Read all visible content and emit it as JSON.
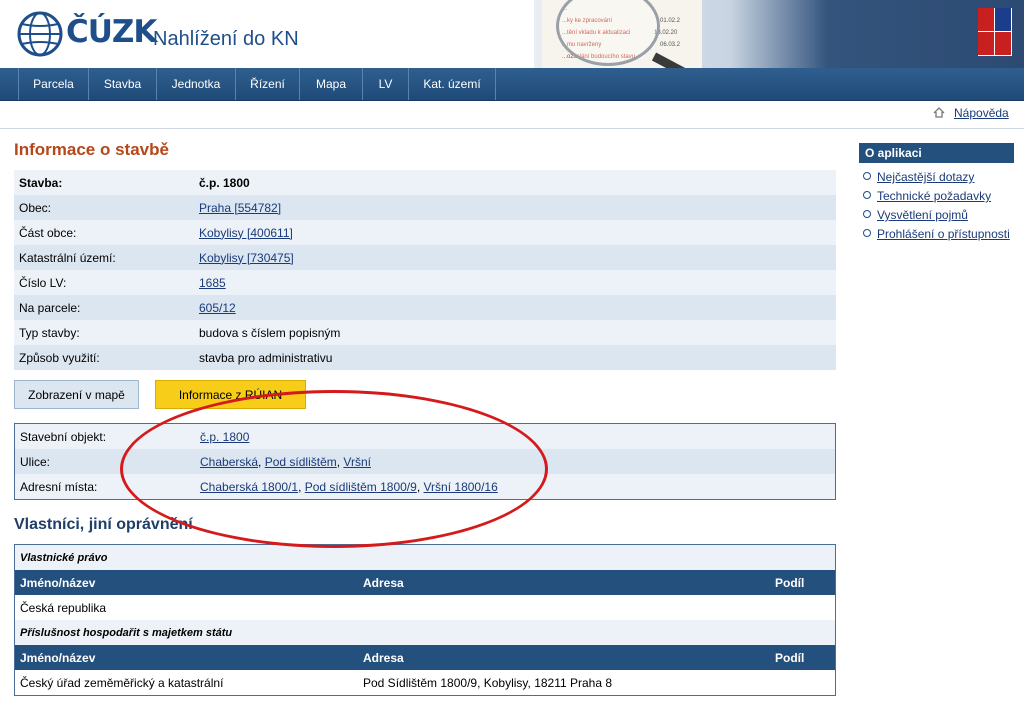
{
  "header": {
    "logo_text": "ČÚZK",
    "app_title": "Nahlížení do KN",
    "banner_lines": [
      "...",
      "...ky ke zpracování",
      "...tění vkladu k aktualizaci",
      "...mu navrženy",
      "...ozaslání budoucího stavu"
    ],
    "banner_dates": [
      "01.02.2",
      "13.02.20",
      "06.03.2"
    ]
  },
  "nav": {
    "items": [
      "Parcela",
      "Stavba",
      "Jednotka",
      "Řízení",
      "Mapa",
      "LV",
      "Kat. území"
    ]
  },
  "help": {
    "label": "Nápověda"
  },
  "page_title": "Informace o stavbě",
  "info": {
    "rows": [
      {
        "key": "Stavba:",
        "value": "č.p. 1800",
        "bold": true
      },
      {
        "key": "Obec:",
        "value": "Praha [554782]",
        "link": true
      },
      {
        "key": "Část obce:",
        "value": "Kobylisy [400611]",
        "link": true
      },
      {
        "key": "Katastrální území:",
        "value": "Kobylisy [730475]",
        "link": true
      },
      {
        "key": "Číslo LV:",
        "value": "1685",
        "link": true
      },
      {
        "key": "Na parcele:",
        "value": "605/12",
        "link": true
      },
      {
        "key": "Typ stavby:",
        "value": "budova s číslem popisným"
      },
      {
        "key": "Způsob využití:",
        "value": "stavba pro administrativu"
      }
    ]
  },
  "buttons": {
    "map": "Zobrazení v mapě",
    "ruian": "Informace z RÚIAN"
  },
  "ruian": {
    "object_label": "Stavební objekt:",
    "object_value": "č.p. 1800",
    "street_label": "Ulice:",
    "streets": [
      "Chaberská",
      "Pod sídlištěm",
      "Vršní"
    ],
    "address_label": "Adresní místa:",
    "addresses": [
      "Chaberská 1800/1",
      "Pod sídlištěm 1800/9",
      "Vršní 1800/16"
    ]
  },
  "owners": {
    "title": "Vlastníci, jiní oprávnění",
    "group1": "Vlastnické právo",
    "group2": "Příslušnost hospodařit s majetkem státu",
    "col_name": "Jméno/název",
    "col_address": "Adresa",
    "col_share": "Podíl",
    "row1_name": "Česká republika",
    "row1_address": "",
    "row2_name": "Český úřad zeměměřický a katastrální",
    "row2_address": "Pod Sídlištěm 1800/9, Kobylisy, 18211 Praha 8"
  },
  "sidebar": {
    "title": "O aplikaci",
    "items": [
      "Nejčastější dotazy",
      "Technické požadavky",
      "Vysvětlení pojmů",
      "Prohlášení o přístupnosti"
    ]
  },
  "colors": {
    "accent": "#24507e",
    "title": "#b5471a",
    "highlight": "#f7cd1a",
    "annotation": "#d41a1a"
  }
}
